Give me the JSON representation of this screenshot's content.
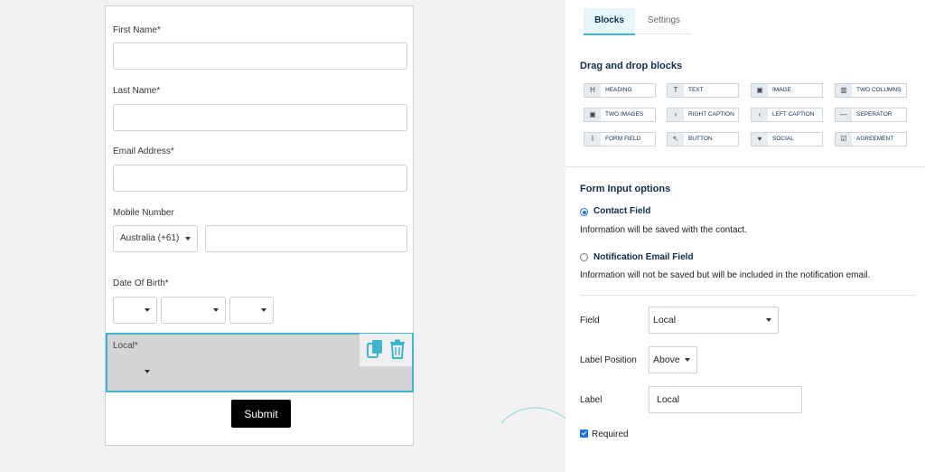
{
  "form": {
    "first_name_label": "First Name*",
    "last_name_label": "Last Name*",
    "email_label": "Email Address*",
    "mobile_label": "Mobile Number",
    "mobile_country": "Australia (+61)",
    "dob_label": "Date Of Birth*",
    "local_label": "Local*",
    "submit_label": "Submit"
  },
  "toolbox": {
    "copy_icon": "copy-icon",
    "trash_icon": "trash-icon",
    "accent_color": "#3fb6cf"
  },
  "panel": {
    "tabs": [
      {
        "label": "Blocks",
        "active": true
      },
      {
        "label": "Settings",
        "active": false
      }
    ],
    "blocks_title": "Drag and drop blocks",
    "blocks": [
      {
        "label": "HEADING",
        "icon": "H"
      },
      {
        "label": "TEXT",
        "icon": "T"
      },
      {
        "label": "IMAGE",
        "icon": "▣"
      },
      {
        "label": "TWO COLUMNS",
        "icon": "▥"
      },
      {
        "label": "TWO IMAGES",
        "icon": "▣"
      },
      {
        "label": "RIGHT CAPTION",
        "icon": "›"
      },
      {
        "label": "LEFT CAPTION",
        "icon": "‹"
      },
      {
        "label": "SEPERATOR",
        "icon": "—"
      },
      {
        "label": "FORM FIELD",
        "icon": "I"
      },
      {
        "label": "BUTTON",
        "icon": "↖"
      },
      {
        "label": "SOCIAL",
        "icon": "♥"
      },
      {
        "label": "AGREEMENT",
        "icon": "☑"
      }
    ],
    "input_options_title": "Form Input options",
    "contact_field_label": "Contact Field",
    "contact_field_desc": "Information will be saved with the contact.",
    "notification_field_label": "Notification Email Field",
    "notification_field_desc": "Information will not be saved but will be included in the notification email.",
    "field_label": "Field",
    "field_value": "Local",
    "label_position_label": "Label Position",
    "label_position_value": "Above",
    "label_label": "Label",
    "label_value": "Local",
    "required_label": "Required",
    "required_checked": true,
    "primary_color": "#1a73e8",
    "heading_color": "#0f2d4f"
  }
}
